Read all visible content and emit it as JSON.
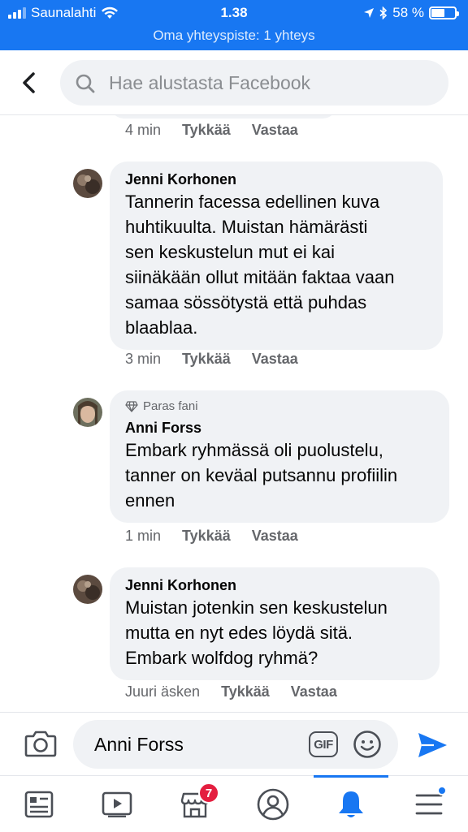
{
  "status_bar": {
    "carrier": "Saunalahti",
    "time": "1.38",
    "battery": "58 %",
    "battery_level": 0.58,
    "hotspot": "Oma yhteyspiste: 1 yhteys"
  },
  "header": {
    "search_placeholder": "Hae alustasta Facebook"
  },
  "comments": [
    {
      "time": "4 min",
      "like": "Tykkää",
      "reply": "Vastaa"
    },
    {
      "author": "Jenni Korhonen",
      "text": "Tannerin facessa edellinen kuva\nhuhtikuulta. Muistan hämärästi\nsen keskustelun mut ei kai\nsiinäkään ollut mitään faktaa vaan\nsamaa sössötystä että puhdas\nblaablaa.",
      "time": "3 min",
      "like": "Tykkää",
      "reply": "Vastaa"
    },
    {
      "badge": "Paras fani",
      "author": "Anni Forss",
      "text": "Embark ryhmässä oli puolustelu,\ntanner on keväal putsannu profiilin\nennen",
      "time": "1 min",
      "like": "Tykkää",
      "reply": "Vastaa"
    },
    {
      "author": "Jenni Korhonen",
      "text": "Muistan jotenkin sen keskustelun\nmutta en nyt edes löydä sitä.\nEmbark wolfdog ryhmä?",
      "time": "Juuri äsken",
      "like": "Tykkää",
      "reply": "Vastaa"
    }
  ],
  "composer": {
    "value": "Anni Forss",
    "gif_label": "GIF"
  },
  "nav": {
    "marketplace_badge": "7"
  },
  "colors": {
    "brand": "#1877f2",
    "bubble": "#f0f2f5",
    "badge": "#e41e3f"
  }
}
